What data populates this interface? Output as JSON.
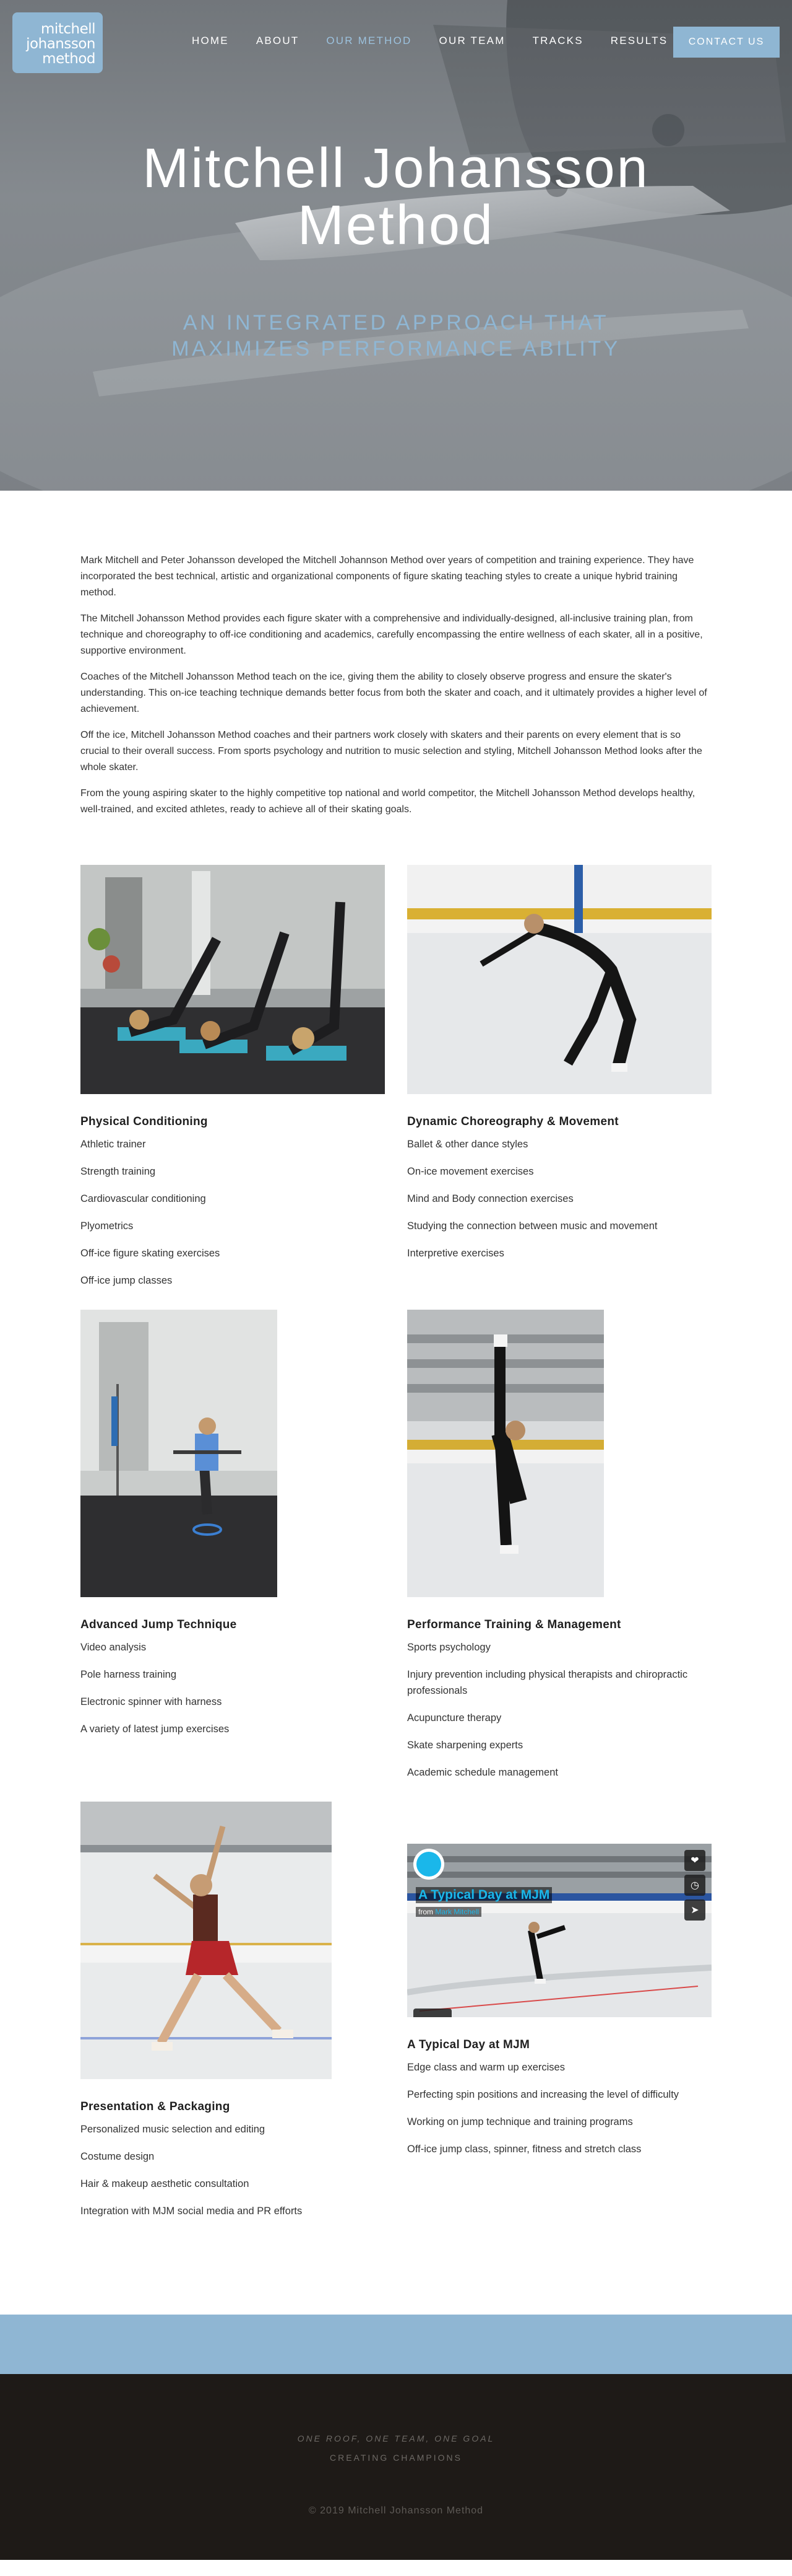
{
  "logo": {
    "line1": "mitchell",
    "line2": "johansson",
    "line3": "method"
  },
  "nav": {
    "items": [
      {
        "label": "HOME"
      },
      {
        "label": "ABOUT"
      },
      {
        "label": "OUR METHOD",
        "active": true
      },
      {
        "label": "OUR TEAM"
      },
      {
        "label": "TRACKS"
      },
      {
        "label": "RESULTS"
      }
    ],
    "cta": "CONTACT US"
  },
  "hero": {
    "title_line1": "Mitchell Johansson",
    "title_line2": "Method",
    "subtitle_line1": "AN INTEGRATED APPROACH THAT",
    "subtitle_line2": "MAXIMIZES PERFORMANCE ABILITY"
  },
  "intro": {
    "paragraphs": [
      "Mark Mitchell and Peter Johansson developed the Mitchell Johannson Method over years of competition and training experience. They have incorporated the best technical, artistic and organizational components of figure skating teaching styles to create a unique hybrid training method.",
      "The Mitchell Johansson Method provides each figure skater with a comprehensive and individually-designed, all-inclusive training plan, from technique and choreography to off-ice conditioning and academics, carefully encompassing the entire wellness of each skater, all in a positive, supportive environment.",
      "Coaches of the Mitchell Johansson Method teach on the ice, giving them the ability to closely observe progress and ensure the skater's understanding. This on-ice teaching technique demands better focus from both the skater and coach, and it ultimately provides a higher level of achievement.",
      "Off the ice, Mitchell Johansson Method coaches and their partners work closely with skaters and their parents on every element that is so crucial to their overall success. From sports psychology and nutrition to music selection and styling, Mitchell Johansson Method looks after the whole skater.",
      "From the young aspiring skater to the highly competitive top national and world competitor, the Mitchell Johansson Method develops healthy, well-trained, and excited athletes, ready to achieve all of their skating goals."
    ]
  },
  "features": {
    "physical": {
      "title": "Physical Conditioning",
      "items": [
        "Athletic trainer",
        "Strength training",
        "Cardiovascular conditioning",
        "Plyometrics",
        "Off-ice figure skating exercises",
        "Off-ice jump classes"
      ]
    },
    "choreography": {
      "title": "Dynamic Choreography & Movement",
      "items": [
        "Ballet & other dance styles",
        "On-ice movement exercises",
        "Mind and Body connection exercises",
        "Studying the connection between music and movement",
        "Interpretive exercises"
      ]
    },
    "jump": {
      "title": "Advanced Jump Technique",
      "items": [
        "Video analysis",
        "Pole harness training",
        "Electronic spinner with harness",
        "A variety of latest jump exercises"
      ]
    },
    "performance": {
      "title": "Performance Training & Management",
      "items": [
        "Sports psychology",
        "Injury prevention including physical therapists and chiropractic professionals",
        "Acupuncture therapy",
        "Skate sharpening experts",
        "Academic schedule management"
      ]
    },
    "presentation": {
      "title": "Presentation & Packaging",
      "items": [
        "Personalized music selection and editing",
        "Costume design",
        "Hair & makeup aesthetic consultation",
        "Integration with MJM social media and PR efforts"
      ]
    },
    "typical_day": {
      "title": "A Typical Day at MJM",
      "items": [
        "Edge class and warm up exercises",
        "Perfecting spin positions and increasing the level of difficulty",
        "Working on jump technique and training programs",
        "Off-ice jump class, spinner, fitness and stretch class"
      ],
      "video": {
        "title": "A Typical Day at MJM",
        "from_prefix": "from",
        "from_name": "Mark Mitchell"
      }
    }
  },
  "footer": {
    "tagline": "ONE ROOF, ONE TEAM, ONE GOAL",
    "creating": "CREATING CHAMPIONS",
    "copyright": "© 2019 Mitchell Johansson Method"
  },
  "icons": {
    "heart": "heart-icon",
    "clock": "clock-icon",
    "send": "paper-plane-icon"
  },
  "colors": {
    "accent": "#8fb6d3",
    "footer_bg": "#1e1a17",
    "vimeo_blue": "#1ab7ea"
  }
}
